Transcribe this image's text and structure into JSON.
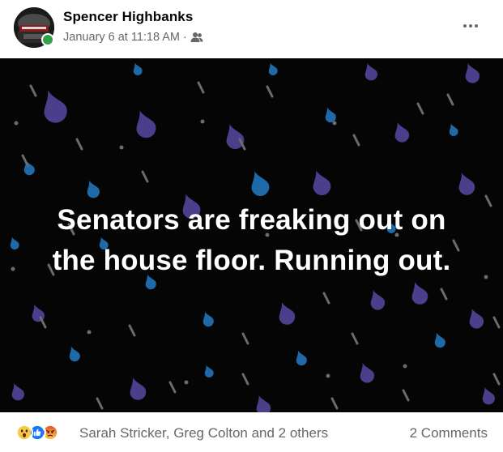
{
  "post": {
    "author_name": "Spencer Highbanks",
    "date": "January 6 at 11:18 AM",
    "separator": "·",
    "audience_icon": "friends-icon",
    "more_icon": "more-options-icon",
    "status_color": "#31a24c"
  },
  "image": {
    "text_line_1": "Senators are freaking out on",
    "text_line_2": "the house floor. Running out.",
    "background_color": "#050505",
    "drop_colors": [
      "#4b3e8a",
      "#1e6aa8",
      "#6b6b70"
    ]
  },
  "footer": {
    "reaction_icons": [
      "wow-reaction-icon",
      "like-reaction-icon",
      "angry-reaction-icon"
    ],
    "reaction_names": "Sarah Stricker, Greg Colton and 2 others",
    "comments_label": "2 Comments"
  }
}
